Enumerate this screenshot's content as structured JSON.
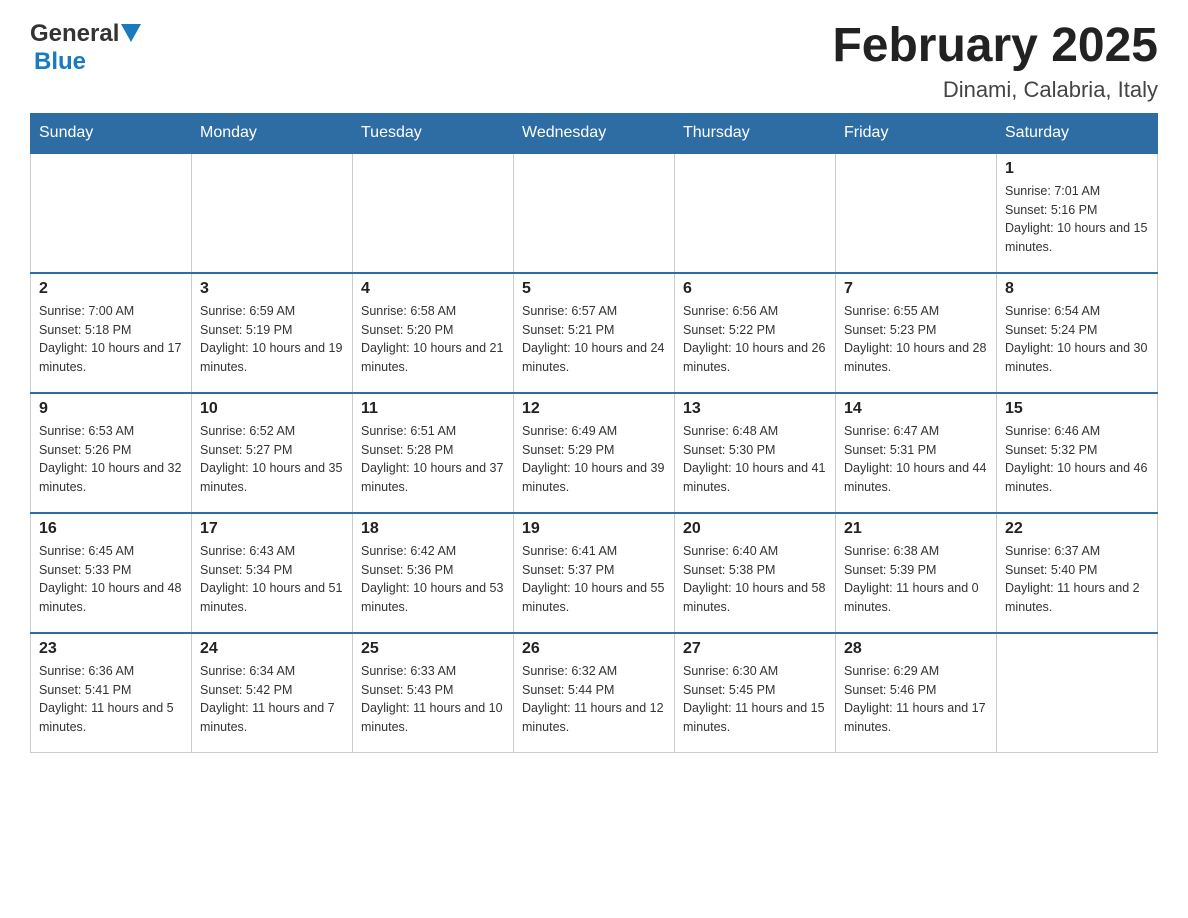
{
  "header": {
    "logo_general": "General",
    "logo_blue": "Blue",
    "month_title": "February 2025",
    "location": "Dinami, Calabria, Italy"
  },
  "days_of_week": [
    "Sunday",
    "Monday",
    "Tuesday",
    "Wednesday",
    "Thursday",
    "Friday",
    "Saturday"
  ],
  "weeks": [
    [
      {
        "day": "",
        "sunrise": "",
        "sunset": "",
        "daylight": ""
      },
      {
        "day": "",
        "sunrise": "",
        "sunset": "",
        "daylight": ""
      },
      {
        "day": "",
        "sunrise": "",
        "sunset": "",
        "daylight": ""
      },
      {
        "day": "",
        "sunrise": "",
        "sunset": "",
        "daylight": ""
      },
      {
        "day": "",
        "sunrise": "",
        "sunset": "",
        "daylight": ""
      },
      {
        "day": "",
        "sunrise": "",
        "sunset": "",
        "daylight": ""
      },
      {
        "day": "1",
        "sunrise": "Sunrise: 7:01 AM",
        "sunset": "Sunset: 5:16 PM",
        "daylight": "Daylight: 10 hours and 15 minutes."
      }
    ],
    [
      {
        "day": "2",
        "sunrise": "Sunrise: 7:00 AM",
        "sunset": "Sunset: 5:18 PM",
        "daylight": "Daylight: 10 hours and 17 minutes."
      },
      {
        "day": "3",
        "sunrise": "Sunrise: 6:59 AM",
        "sunset": "Sunset: 5:19 PM",
        "daylight": "Daylight: 10 hours and 19 minutes."
      },
      {
        "day": "4",
        "sunrise": "Sunrise: 6:58 AM",
        "sunset": "Sunset: 5:20 PM",
        "daylight": "Daylight: 10 hours and 21 minutes."
      },
      {
        "day": "5",
        "sunrise": "Sunrise: 6:57 AM",
        "sunset": "Sunset: 5:21 PM",
        "daylight": "Daylight: 10 hours and 24 minutes."
      },
      {
        "day": "6",
        "sunrise": "Sunrise: 6:56 AM",
        "sunset": "Sunset: 5:22 PM",
        "daylight": "Daylight: 10 hours and 26 minutes."
      },
      {
        "day": "7",
        "sunrise": "Sunrise: 6:55 AM",
        "sunset": "Sunset: 5:23 PM",
        "daylight": "Daylight: 10 hours and 28 minutes."
      },
      {
        "day": "8",
        "sunrise": "Sunrise: 6:54 AM",
        "sunset": "Sunset: 5:24 PM",
        "daylight": "Daylight: 10 hours and 30 minutes."
      }
    ],
    [
      {
        "day": "9",
        "sunrise": "Sunrise: 6:53 AM",
        "sunset": "Sunset: 5:26 PM",
        "daylight": "Daylight: 10 hours and 32 minutes."
      },
      {
        "day": "10",
        "sunrise": "Sunrise: 6:52 AM",
        "sunset": "Sunset: 5:27 PM",
        "daylight": "Daylight: 10 hours and 35 minutes."
      },
      {
        "day": "11",
        "sunrise": "Sunrise: 6:51 AM",
        "sunset": "Sunset: 5:28 PM",
        "daylight": "Daylight: 10 hours and 37 minutes."
      },
      {
        "day": "12",
        "sunrise": "Sunrise: 6:49 AM",
        "sunset": "Sunset: 5:29 PM",
        "daylight": "Daylight: 10 hours and 39 minutes."
      },
      {
        "day": "13",
        "sunrise": "Sunrise: 6:48 AM",
        "sunset": "Sunset: 5:30 PM",
        "daylight": "Daylight: 10 hours and 41 minutes."
      },
      {
        "day": "14",
        "sunrise": "Sunrise: 6:47 AM",
        "sunset": "Sunset: 5:31 PM",
        "daylight": "Daylight: 10 hours and 44 minutes."
      },
      {
        "day": "15",
        "sunrise": "Sunrise: 6:46 AM",
        "sunset": "Sunset: 5:32 PM",
        "daylight": "Daylight: 10 hours and 46 minutes."
      }
    ],
    [
      {
        "day": "16",
        "sunrise": "Sunrise: 6:45 AM",
        "sunset": "Sunset: 5:33 PM",
        "daylight": "Daylight: 10 hours and 48 minutes."
      },
      {
        "day": "17",
        "sunrise": "Sunrise: 6:43 AM",
        "sunset": "Sunset: 5:34 PM",
        "daylight": "Daylight: 10 hours and 51 minutes."
      },
      {
        "day": "18",
        "sunrise": "Sunrise: 6:42 AM",
        "sunset": "Sunset: 5:36 PM",
        "daylight": "Daylight: 10 hours and 53 minutes."
      },
      {
        "day": "19",
        "sunrise": "Sunrise: 6:41 AM",
        "sunset": "Sunset: 5:37 PM",
        "daylight": "Daylight: 10 hours and 55 minutes."
      },
      {
        "day": "20",
        "sunrise": "Sunrise: 6:40 AM",
        "sunset": "Sunset: 5:38 PM",
        "daylight": "Daylight: 10 hours and 58 minutes."
      },
      {
        "day": "21",
        "sunrise": "Sunrise: 6:38 AM",
        "sunset": "Sunset: 5:39 PM",
        "daylight": "Daylight: 11 hours and 0 minutes."
      },
      {
        "day": "22",
        "sunrise": "Sunrise: 6:37 AM",
        "sunset": "Sunset: 5:40 PM",
        "daylight": "Daylight: 11 hours and 2 minutes."
      }
    ],
    [
      {
        "day": "23",
        "sunrise": "Sunrise: 6:36 AM",
        "sunset": "Sunset: 5:41 PM",
        "daylight": "Daylight: 11 hours and 5 minutes."
      },
      {
        "day": "24",
        "sunrise": "Sunrise: 6:34 AM",
        "sunset": "Sunset: 5:42 PM",
        "daylight": "Daylight: 11 hours and 7 minutes."
      },
      {
        "day": "25",
        "sunrise": "Sunrise: 6:33 AM",
        "sunset": "Sunset: 5:43 PM",
        "daylight": "Daylight: 11 hours and 10 minutes."
      },
      {
        "day": "26",
        "sunrise": "Sunrise: 6:32 AM",
        "sunset": "Sunset: 5:44 PM",
        "daylight": "Daylight: 11 hours and 12 minutes."
      },
      {
        "day": "27",
        "sunrise": "Sunrise: 6:30 AM",
        "sunset": "Sunset: 5:45 PM",
        "daylight": "Daylight: 11 hours and 15 minutes."
      },
      {
        "day": "28",
        "sunrise": "Sunrise: 6:29 AM",
        "sunset": "Sunset: 5:46 PM",
        "daylight": "Daylight: 11 hours and 17 minutes."
      },
      {
        "day": "",
        "sunrise": "",
        "sunset": "",
        "daylight": ""
      }
    ]
  ]
}
